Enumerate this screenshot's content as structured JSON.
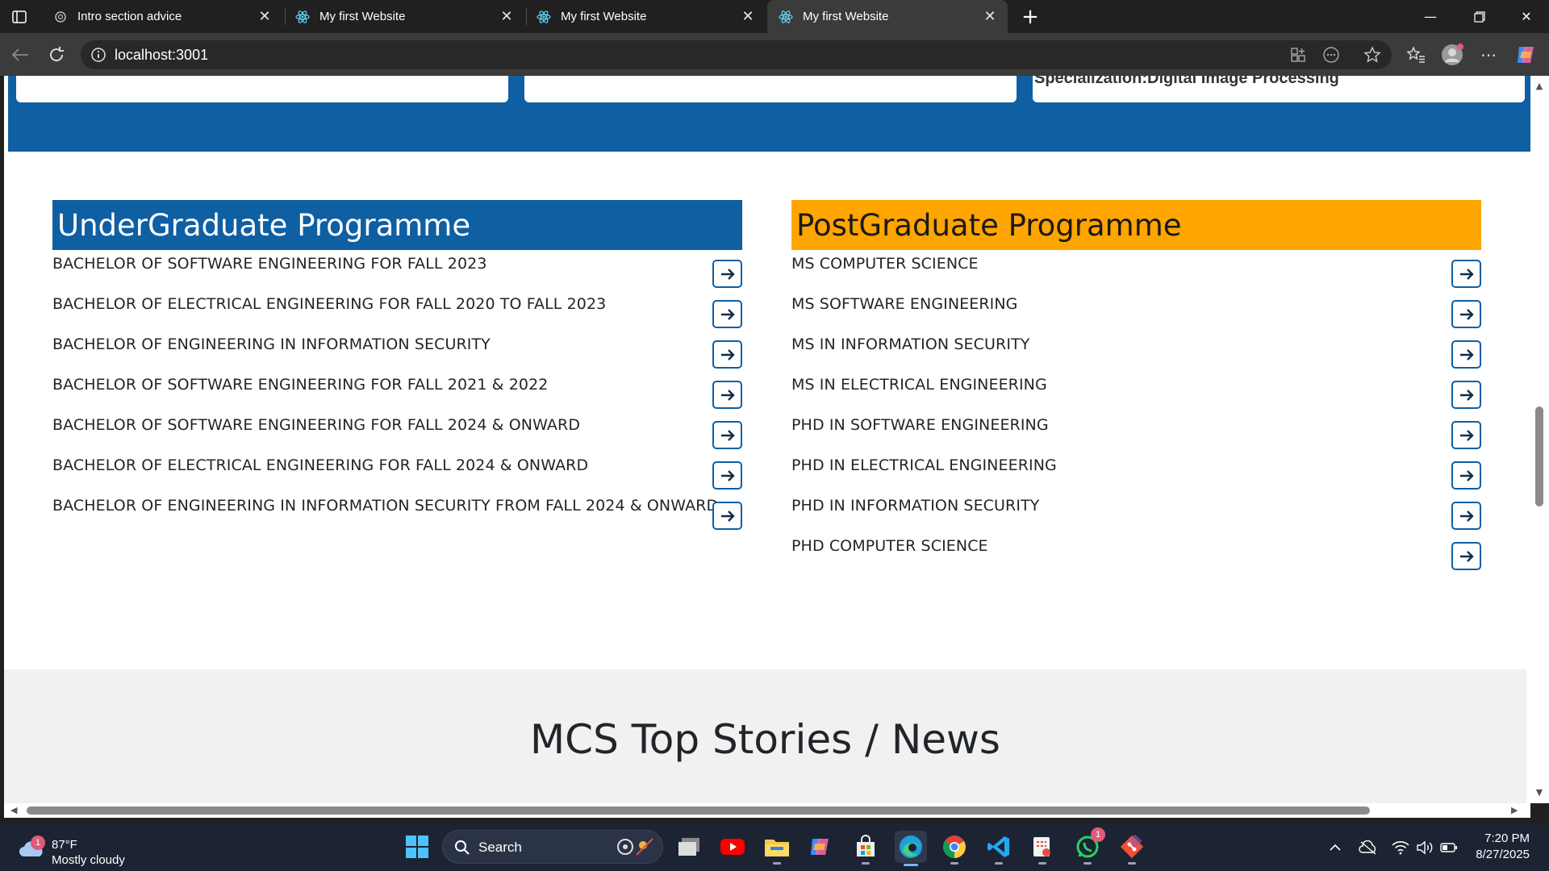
{
  "browser": {
    "tabs": [
      {
        "title": "Intro section advice",
        "favicon": "openai-icon"
      },
      {
        "title": "My first Website",
        "favicon": "react-icon"
      },
      {
        "title": "My first Website",
        "favicon": "react-icon"
      },
      {
        "title": "My first Website",
        "favicon": "react-icon",
        "active": true
      }
    ],
    "url": "localhost:3001"
  },
  "page": {
    "top_card_partial_text": "Specialization:Digital Image Processing",
    "undergraduate": {
      "heading": "UnderGraduate Programme",
      "items": [
        "BACHELOR OF SOFTWARE ENGINEERING FOR FALL 2023",
        "BACHELOR OF ELECTRICAL ENGINEERING FOR FALL 2020 TO FALL 2023",
        "BACHELOR OF ENGINEERING IN INFORMATION SECURITY",
        "BACHELOR OF SOFTWARE ENGINEERING FOR FALL 2021 & 2022",
        "BACHELOR OF SOFTWARE ENGINEERING FOR FALL 2024 & ONWARD",
        "BACHELOR OF ELECTRICAL ENGINEERING FOR FALL 2024 & ONWARD",
        "BACHELOR OF ENGINEERING IN INFORMATION SECURITY FROM FALL 2024 & ONWARD"
      ]
    },
    "postgraduate": {
      "heading": "PostGraduate Programme",
      "items": [
        "MS COMPUTER SCIENCE",
        "MS SOFTWARE ENGINEERING",
        "MS IN INFORMATION SECURITY",
        "MS IN ELECTRICAL ENGINEERING",
        "PHD IN SOFTWARE ENGINEERING",
        "PHD IN ELECTRICAL ENGINEERING",
        "PHD IN INFORMATION SECURITY",
        "PHD COMPUTER SCIENCE"
      ]
    },
    "news_heading": "MCS Top Stories / News"
  },
  "colors": {
    "primary_blue": "#0f5fa3",
    "accent_orange": "#ffa500",
    "news_bg": "#f1f1f1"
  },
  "taskbar": {
    "weather_temp": "87°F",
    "weather_condition": "Mostly cloudy",
    "weather_badge": "1",
    "search_label": "Search",
    "whatsapp_badge": "1",
    "time": "7:20 PM",
    "date": "8/27/2025"
  }
}
